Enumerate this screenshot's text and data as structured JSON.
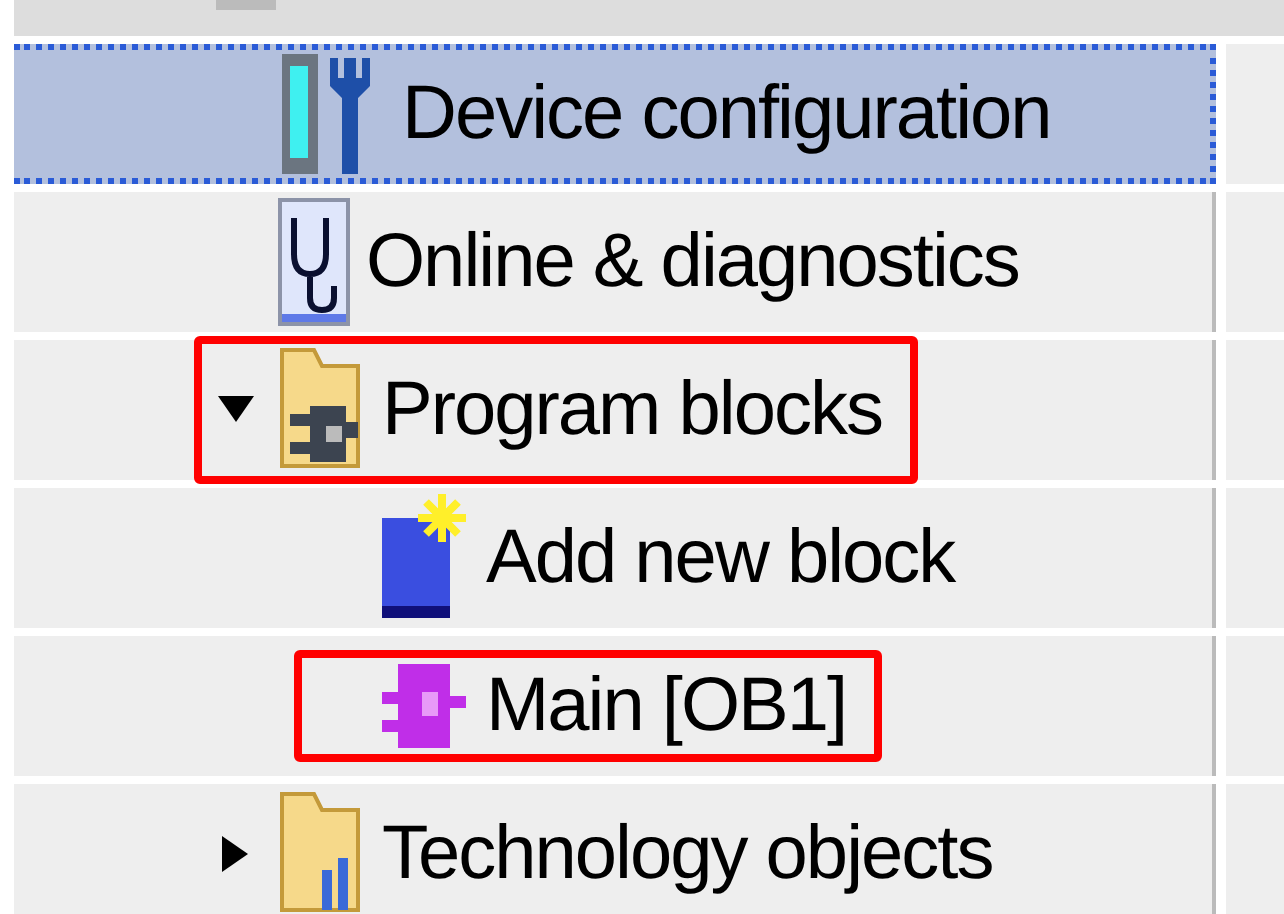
{
  "tree": [
    {
      "label": "Device configuration",
      "kind": "device-config",
      "selected": true,
      "highlighted": false
    },
    {
      "label": "Online & diagnostics",
      "kind": "diagnostics",
      "selected": false,
      "highlighted": false
    },
    {
      "label": "Program blocks",
      "kind": "folder-block",
      "selected": false,
      "highlighted": true,
      "expanded": true,
      "children": [
        {
          "label": "Add new block",
          "kind": "add-block",
          "selected": false,
          "highlighted": false
        },
        {
          "label": "Main [OB1]",
          "kind": "ob-block",
          "selected": false,
          "highlighted": true
        }
      ]
    },
    {
      "label": "Technology objects",
      "kind": "folder-tech",
      "selected": false,
      "highlighted": false,
      "expanded": false
    }
  ]
}
